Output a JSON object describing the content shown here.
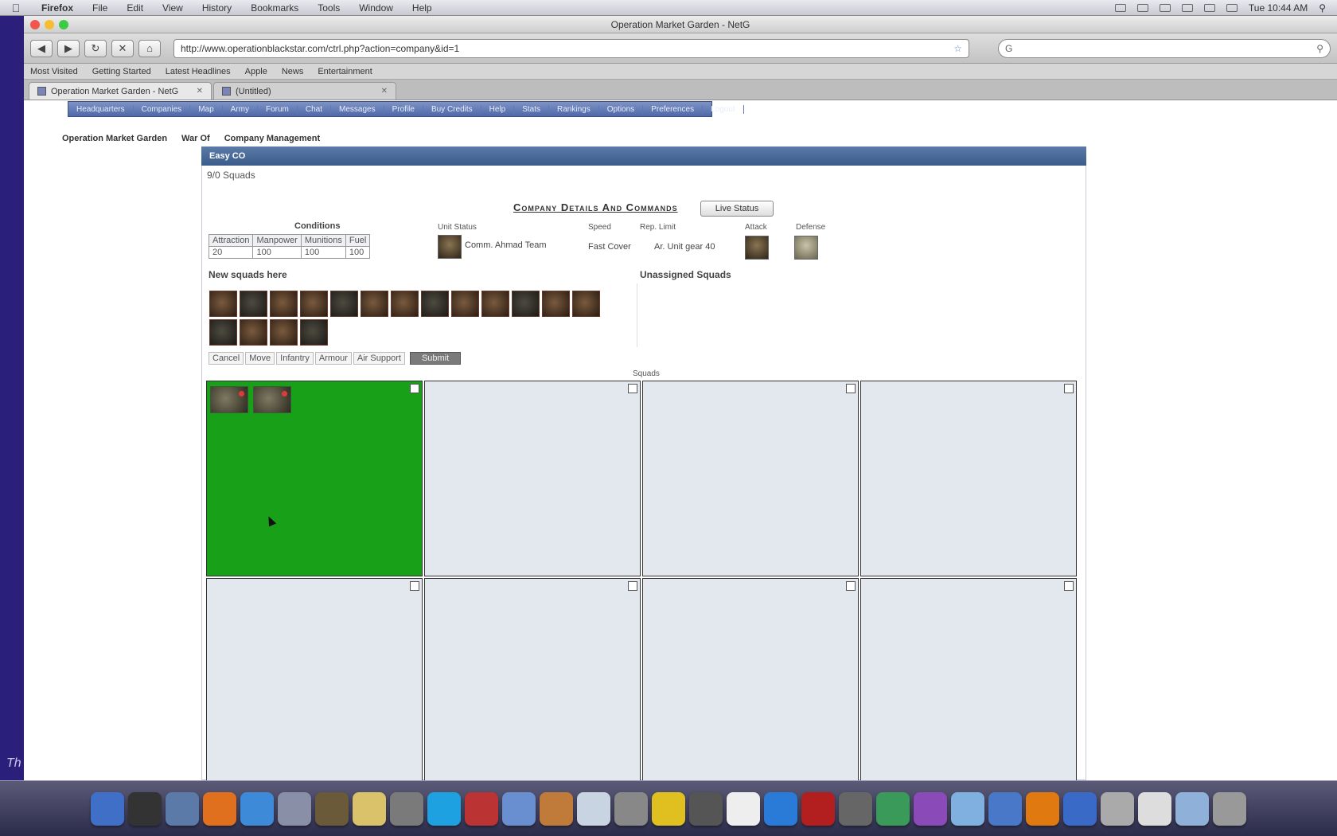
{
  "menubar": {
    "app_name": "Firefox",
    "items": [
      "File",
      "Edit",
      "View",
      "History",
      "Bookmarks",
      "Tools",
      "Window",
      "Help"
    ],
    "clock": "Tue 10:44 AM"
  },
  "browser": {
    "window_title": "Operation Market Garden - NetG",
    "url": "http://www.operationblackstar.com/ctrl.php?action=company&id=1",
    "search_placeholder": "G",
    "bookmarks": [
      "Most Visited",
      "Getting Started",
      "Latest Headlines",
      "Apple",
      "News",
      "Entertainment"
    ],
    "tabs": [
      {
        "label": "Operation Market Garden - NetG",
        "active": true
      },
      {
        "label": "(Untitled)",
        "active": false
      }
    ]
  },
  "site": {
    "nav": [
      "Headquarters",
      "Companies",
      "Map",
      "Army",
      "Forum",
      "Chat",
      "Messages",
      "Profile",
      "Buy Credits",
      "Help",
      "Stats",
      "Rankings",
      "Options",
      "Preferences",
      "Logout"
    ],
    "breadcrumb": [
      "Operation Market Garden",
      "War Of",
      "Company Management"
    ]
  },
  "panel": {
    "header": "Easy CO",
    "squad_count": "9/0 Squads",
    "company_title": "Company Details And Commands",
    "live_status_button": "Live Status",
    "condition_title": "Conditions",
    "conditions": {
      "headers": [
        "Attraction",
        "Manpower",
        "Munitions",
        "Fuel"
      ],
      "values": [
        "20",
        "100",
        "100",
        "100"
      ]
    },
    "info": {
      "unit_label": "Unit Status",
      "commander": "Comm. Ahmad Team",
      "speed_label": "Speed",
      "speed_value": "Fast Cover",
      "rep_label": "Rep. Limit",
      "rep_value": "Ar. Unit gear 40",
      "attack_label": "Attack",
      "defense_label": "Defense"
    },
    "new_squads_title": "New squads here",
    "unassigned_title": "Unassigned Squads",
    "actions": [
      "Cancel",
      "Move",
      "Infantry",
      "Armour",
      "Air Support",
      "Submit"
    ],
    "slots_label": "Squads",
    "slot_count": 8,
    "filled_slot_index": 0,
    "filled_slot_squads": 2,
    "new_squad_count": 17
  },
  "dock": {
    "apps": [
      "Finder",
      "Dashboard",
      "Mail",
      "Firefox",
      "Safari",
      "Preview",
      "Photo",
      "Stickies",
      "Tools",
      "Skype",
      "Chess",
      "iTunes",
      "Garage",
      "Folder",
      "System",
      "Nuke",
      "Console",
      "iCal",
      "Chrome",
      "Books",
      "Monitor",
      "Sync",
      "Photo Booth",
      "Sticky",
      "Utilities",
      "VLC",
      "Network",
      "Server",
      "Docs",
      "Downloads",
      "Trash"
    ]
  },
  "colors": {
    "desktop": "#2a1f7a",
    "panel_header": "#3b5b8a",
    "nav_bar": "#4f69a8",
    "filled_slot": "#18a018",
    "empty_slot": "#e3e8ef"
  }
}
